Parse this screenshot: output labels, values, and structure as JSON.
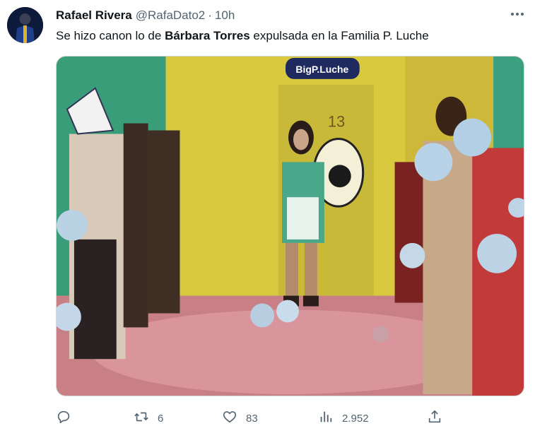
{
  "tweet": {
    "author_name": "Rafael Rivera",
    "handle": "@RafaDato2",
    "separator": "·",
    "time": "10h",
    "text_before": "Se hizo canon lo de ",
    "text_bold": "Bárbara Torres",
    "text_after": " expulsada en la Familia P. Luche"
  },
  "media": {
    "sign_text": "BigP.Luche",
    "door_number": "13"
  },
  "actions": {
    "reply_count": "",
    "retweet_count": "6",
    "like_count": "83",
    "views_count": "2.952"
  },
  "icons": {
    "more": "more-dots-icon",
    "reply": "reply-bubble-icon",
    "retweet": "retweet-icon",
    "like": "heart-icon",
    "views": "views-bars-icon",
    "share": "share-upload-icon"
  },
  "colors": {
    "text_primary": "#0f1419",
    "text_secondary": "#536471",
    "media_border": "#cfd9de"
  }
}
